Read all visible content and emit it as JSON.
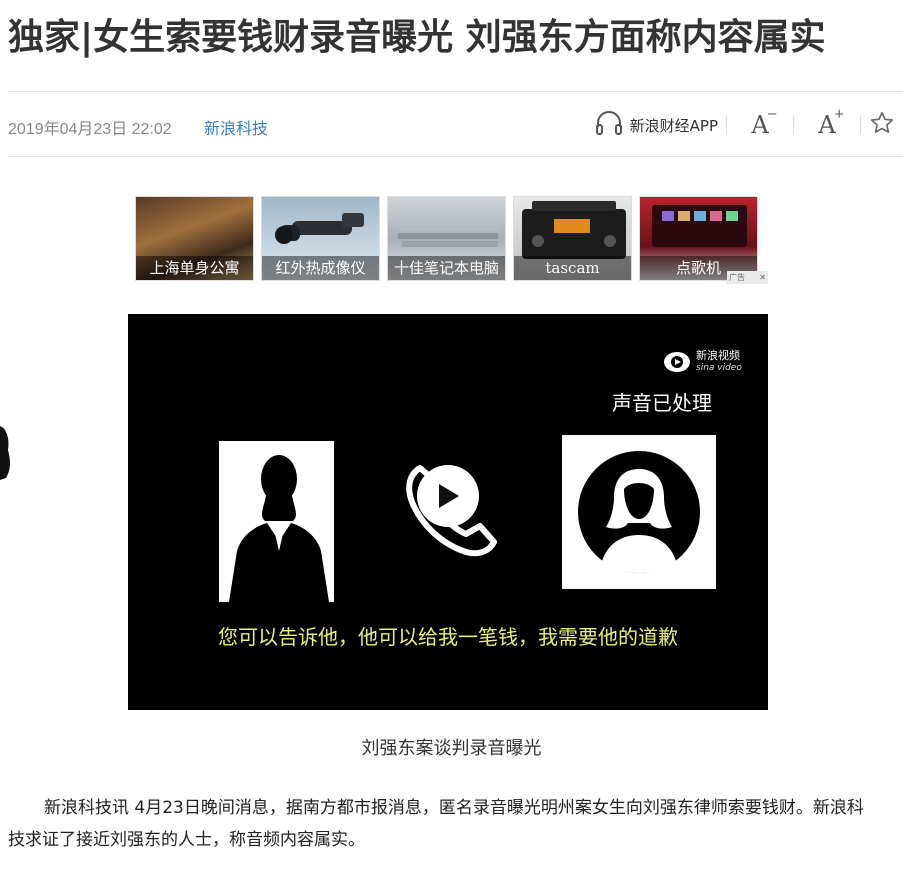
{
  "article": {
    "title": "独家|女生索要钱财录音曝光 刘强东方面称内容属实",
    "date": "2019年04月23日 22:02",
    "source": "新浪科技"
  },
  "toolbar": {
    "app_label": "新浪财经APP",
    "font_decrease": "A",
    "font_decrease_mark": "−",
    "font_increase": "A",
    "font_increase_mark": "+"
  },
  "ads": {
    "items": [
      {
        "label": "上海单身公寓"
      },
      {
        "label": "红外热成像仪"
      },
      {
        "label": "十佳笔记本电脑"
      },
      {
        "label": "tascam"
      },
      {
        "label": "点歌机"
      }
    ],
    "tag": "广告"
  },
  "video": {
    "logo_cn": "新浪视频",
    "logo_en": "sina video",
    "processed_note": "声音已处理",
    "subtitle": "您可以告诉他，他可以给我一笔钱，我需要他的道歉"
  },
  "caption": "刘强东案谈判录音曝光",
  "body": {
    "paragraph1": "新浪科技讯 4月23日晚间消息，据南方都市报消息，匿名录音曝光明州案女生向刘强东律师索要钱财。新浪科技求证了接近刘强东的人士，称音频内容属实。"
  },
  "colors": {
    "source_link": "#3a7fbf",
    "subtitle": "#e9f07a",
    "video_bg": "#000000"
  }
}
